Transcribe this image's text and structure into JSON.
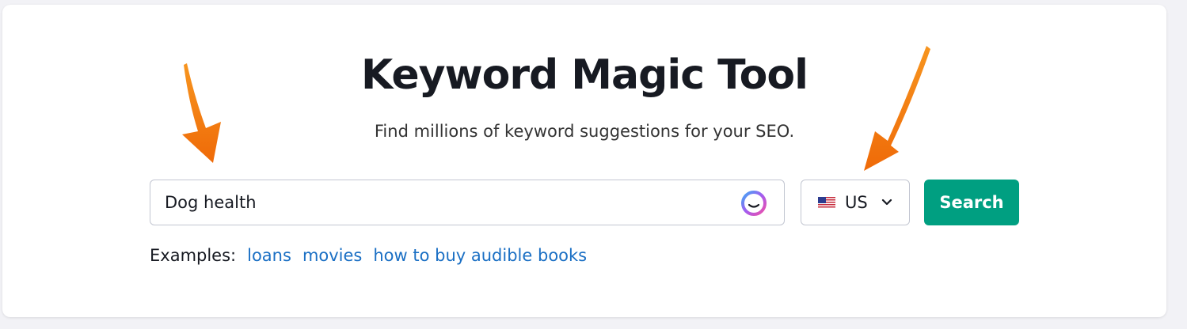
{
  "header": {
    "title": "Keyword Magic Tool",
    "subtitle": "Find millions of keyword suggestions for your SEO."
  },
  "search": {
    "value": "Dog health"
  },
  "database": {
    "selected": "US",
    "flag_icon": "us-flag-icon"
  },
  "actions": {
    "search_label": "Search"
  },
  "examples": {
    "label": "Examples:",
    "links": [
      "loans",
      "movies",
      "how to buy audible books"
    ]
  },
  "colors": {
    "accent": "#009f81",
    "link": "#1a6fc4",
    "annotation_arrow": "#f47a0e"
  }
}
